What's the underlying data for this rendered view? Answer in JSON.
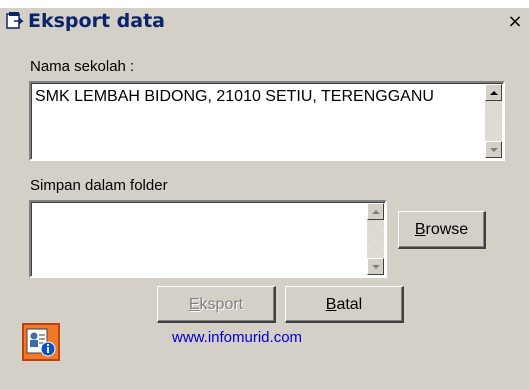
{
  "window": {
    "title": "Eksport data",
    "close_glyph": "×",
    "title_icon": "app-window-icon"
  },
  "form": {
    "school_label": "Nama sekolah :",
    "school_value": "SMK LEMBAH BIDONG, 21010 SETIU, TERENGGANU",
    "folder_label": "Simpan dalam folder",
    "folder_value": ""
  },
  "buttons": {
    "browse_label": "Browse",
    "browse_mnemonic": "B",
    "browse_rest": "rowse",
    "export_label": "Eksport",
    "export_mnemonic": "E",
    "export_rest": "ksport",
    "cancel_label": "Batal",
    "cancel_mnemonic": "B",
    "cancel_rest": "atal"
  },
  "footer": {
    "website": "www.infomurid.com",
    "icon": "user-info-icon"
  },
  "colors": {
    "face": "#d4d0c8",
    "title_text": "#0a246a",
    "link": "#0000cc",
    "icon_bg": "#f07a28"
  }
}
